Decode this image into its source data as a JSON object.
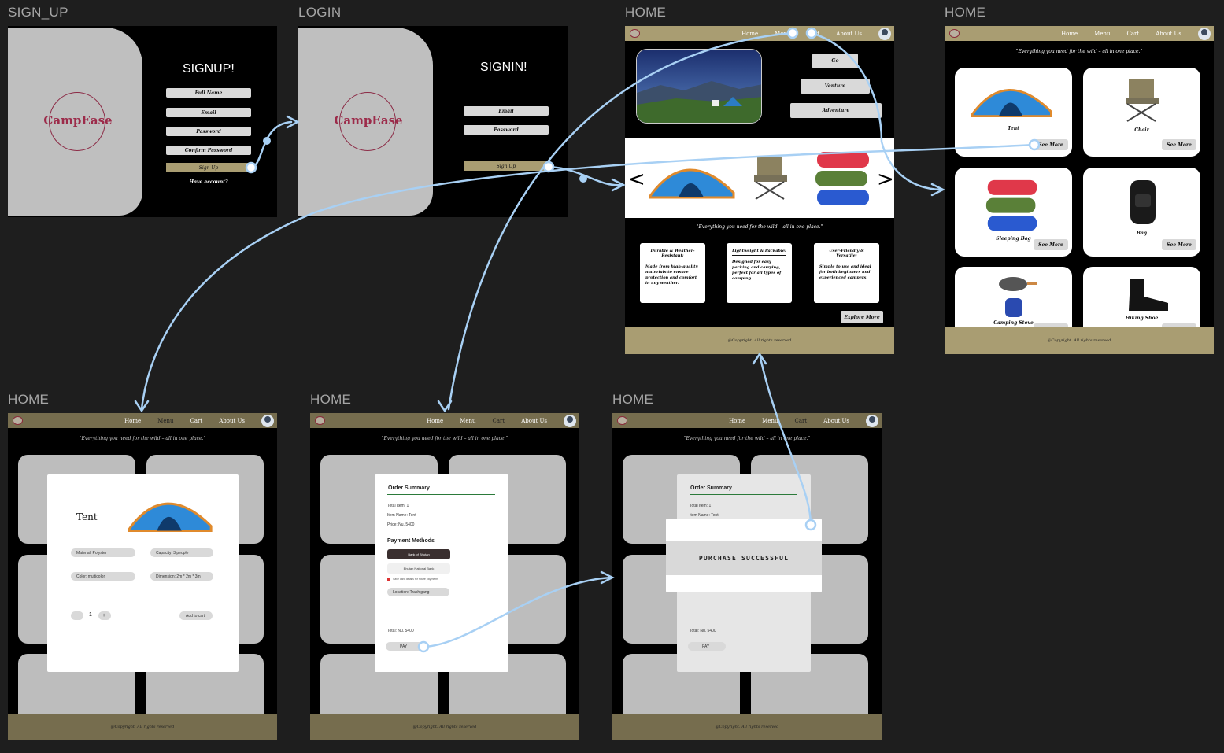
{
  "frame_labels": {
    "signup": "SIGN_UP",
    "login": "LOGIN",
    "home1": "HOME",
    "home2": "HOME",
    "home3": "HOME",
    "home4": "HOME",
    "home5": "HOME"
  },
  "brand": {
    "logo_text": "CampEase"
  },
  "signup": {
    "title": "SIGNUP!",
    "fields": [
      "Full Name",
      "Email",
      "Password",
      "Confirm Password"
    ],
    "button": "Sign Up",
    "link": "Have account?"
  },
  "login": {
    "title": "SIGNIN!",
    "fields": [
      "Email",
      "Password"
    ],
    "button": "Sign Up"
  },
  "nav": {
    "items": [
      "Home",
      "Menu",
      "Cart",
      "About Us"
    ]
  },
  "home": {
    "buttons": [
      "Go",
      "Venture",
      "Adventure"
    ],
    "quote": "\"Everything you need for the wild – all in one place.\"",
    "features": [
      {
        "title": "Durable & Weather-Resistant:",
        "body": "Made from high-quality materials to ensure protection and comfort in any weather."
      },
      {
        "title": "Lightweight & Packable:",
        "body": "Designed for easy packing and carrying, perfect for all types of camping."
      },
      {
        "title": "User-Friendly & Versatile:",
        "body": "Simple to use and ideal for both beginners and experienced campers."
      }
    ],
    "explore": "Explore More",
    "footer": "@Copyright. All rights reserved"
  },
  "menu": {
    "quote": "\"Everything you need for the wild – all in one place.\"",
    "products": [
      "Tent",
      "Chair",
      "Sleeping Bag",
      "Bag",
      "Camping Stove",
      "Hiking Shoe"
    ],
    "see_more": "See More"
  },
  "tent_modal": {
    "name": "Tent",
    "specs": [
      "Material: Polyster",
      "Capacity: 3 people",
      "Color: multicolor",
      "Dimension: 2m * 2m * 3m"
    ],
    "minus": "−",
    "qty": "1",
    "plus": "+",
    "add_to_cart": "Add to cart"
  },
  "order": {
    "title": "Order Summary",
    "total_items": "Total Item: 1",
    "item_name": "Item Name: Tent",
    "price": "Price: Nu. 5400",
    "payment_title": "Payment Methods",
    "bank1": "Bank of Bhutan",
    "bank2": "Bhutan National Bank",
    "save_note": "Save card details for future payments",
    "location": "Location: Trashigang",
    "total": "Total: Nu. 5400",
    "pay": "PAY"
  },
  "success": {
    "message": "PURCHASE SUCCESSFUL"
  },
  "colors": {
    "tan": "#a99d72",
    "connector": "#a8d0f4",
    "brand": "#9c2b4a"
  }
}
